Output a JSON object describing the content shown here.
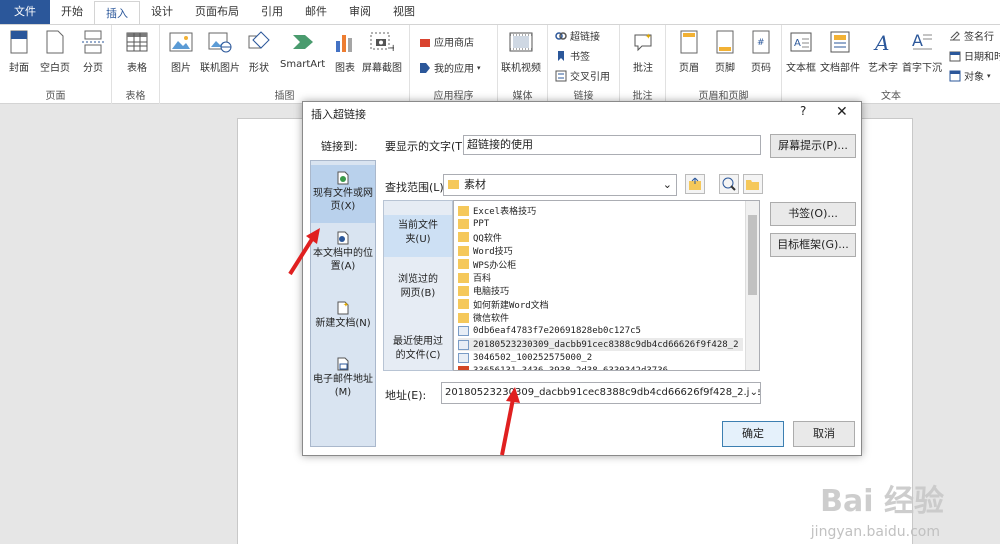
{
  "tabs": [
    "文件",
    "开始",
    "插入",
    "设计",
    "页面布局",
    "引用",
    "邮件",
    "审阅",
    "视图"
  ],
  "ribbon": {
    "groups": [
      "页面",
      "表格",
      "插图",
      "应用程序",
      "媒体",
      "链接",
      "批注",
      "页眉和页脚",
      "文本"
    ],
    "buttons": {
      "cover": "封面",
      "blank": "空白页",
      "pagebreak": "分页",
      "table": "表格",
      "picture": "图片",
      "online_picture": "联机图片",
      "shapes": "形状",
      "smartart": "SmartArt",
      "chart": "图表",
      "screenshot": "屏幕截图",
      "store": "应用商店",
      "myapps": "我的应用",
      "online_video": "联机视频",
      "hyperlink": "超链接",
      "bookmark": "书签",
      "crossref": "交叉引用",
      "comment": "批注",
      "header": "页眉",
      "footer": "页脚",
      "pagenum": "页码",
      "textbox": "文本框",
      "quickparts": "文档部件",
      "wordart": "艺术字",
      "dropcap": "首字下沉",
      "signature": "签名行",
      "datetime": "日期和时",
      "object": "对象"
    }
  },
  "dialog": {
    "title": "插入超链接",
    "help": "?",
    "close": "✕",
    "link_to": "链接到:",
    "display_text_label": "要显示的文字(T):",
    "display_text_value": "超链接的使用",
    "screentip": "屏幕提示(P)...",
    "lookin_label": "查找范围(L):",
    "lookin_value": "素材",
    "bookmark_btn": "书签(O)...",
    "target_frame_btn": "目标框架(G)...",
    "address_label": "地址(E):",
    "address_value": "20180523230309_dacbb91cec8388c9db4cd66626f9f428_2.jpe",
    "ok": "确定",
    "cancel": "取消",
    "link_types": [
      {
        "label1": "现有文件或网",
        "label2": "页(X)"
      },
      {
        "label1": "本文档中的位",
        "label2": "置(A)"
      },
      {
        "label1": "新建文档(N)",
        "label2": ""
      },
      {
        "label1": "电子邮件地址",
        "label2": "(M)"
      }
    ],
    "nav": [
      {
        "label1": "当前文件",
        "label2": "夹(U)"
      },
      {
        "label1": "浏览过的",
        "label2": "网页(B)"
      },
      {
        "label1": "最近使用过",
        "label2": "的文件(C)"
      }
    ],
    "files": [
      {
        "name": "Excel表格技巧",
        "type": "folder"
      },
      {
        "name": "PPT",
        "type": "folder"
      },
      {
        "name": "QQ软件",
        "type": "folder"
      },
      {
        "name": "Word技巧",
        "type": "folder"
      },
      {
        "name": "WPS办公柜",
        "type": "folder"
      },
      {
        "name": "百科",
        "type": "folder"
      },
      {
        "name": "电脑技巧",
        "type": "folder"
      },
      {
        "name": "如何新建Word文档",
        "type": "folder"
      },
      {
        "name": "微信软件",
        "type": "folder"
      },
      {
        "name": "0db6eaf4783f7e20691828eb0c127c5",
        "type": "jpg"
      },
      {
        "name": "20180523230309_dacbb91cec8388c9db4cd66626f9f428_2",
        "type": "jpg"
      },
      {
        "name": "3046502_100252575000_2",
        "type": "jpg"
      },
      {
        "name": "33656131-3436-3938-2d38-6330342d3736",
        "type": "ppt"
      }
    ]
  },
  "watermark": {
    "main": "Bai 经验",
    "sub": "jingyan.baidu.com"
  }
}
